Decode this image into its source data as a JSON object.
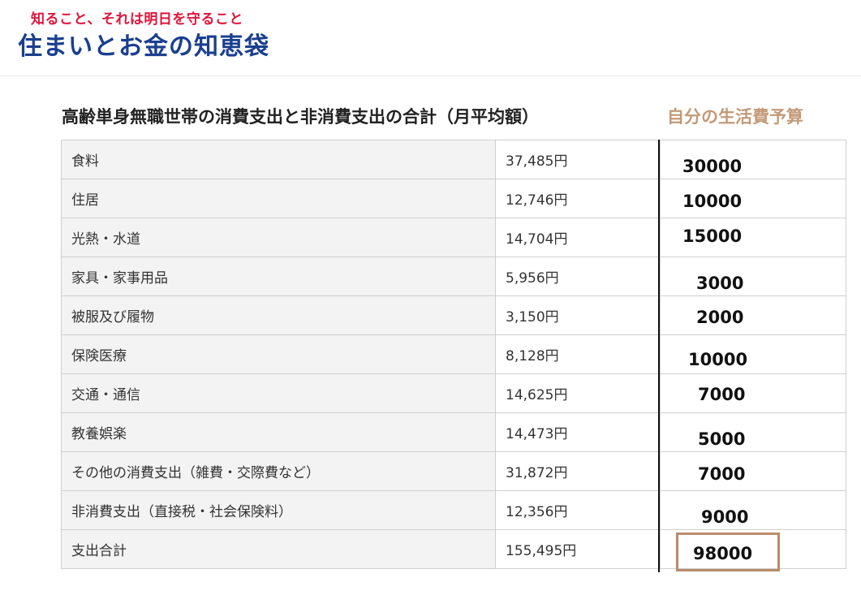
{
  "header": {
    "tagline": "知ること、それは明日を守ること",
    "site_name": "住まいとお金の知恵袋"
  },
  "table_title": "高齢単身無職世帯の消費支出と非消費支出の合計（月平均額）",
  "budget_title": "自分の生活費予算",
  "rows": [
    {
      "category": "食料",
      "amount": "37,485円",
      "budget": "30000"
    },
    {
      "category": "住居",
      "amount": "12,746円",
      "budget": "10000"
    },
    {
      "category": "光熱・水道",
      "amount": "14,704円",
      "budget": "15000"
    },
    {
      "category": "家具・家事用品",
      "amount": "5,956円",
      "budget": "3000"
    },
    {
      "category": "被服及び履物",
      "amount": "3,150円",
      "budget": "2000"
    },
    {
      "category": "保険医療",
      "amount": "8,128円",
      "budget": "10000"
    },
    {
      "category": "交通・通信",
      "amount": "14,625円",
      "budget": "7000"
    },
    {
      "category": "教養娯楽",
      "amount": "14,473円",
      "budget": "5000"
    },
    {
      "category": "その他の消費支出（雑費・交際費など）",
      "amount": "31,872円",
      "budget": "7000"
    },
    {
      "category": "非消費支出（直接税・社会保険料）",
      "amount": "12,356円",
      "budget": "9000"
    },
    {
      "category": "支出合計",
      "amount": "155,495円",
      "budget": "98000"
    }
  ]
}
